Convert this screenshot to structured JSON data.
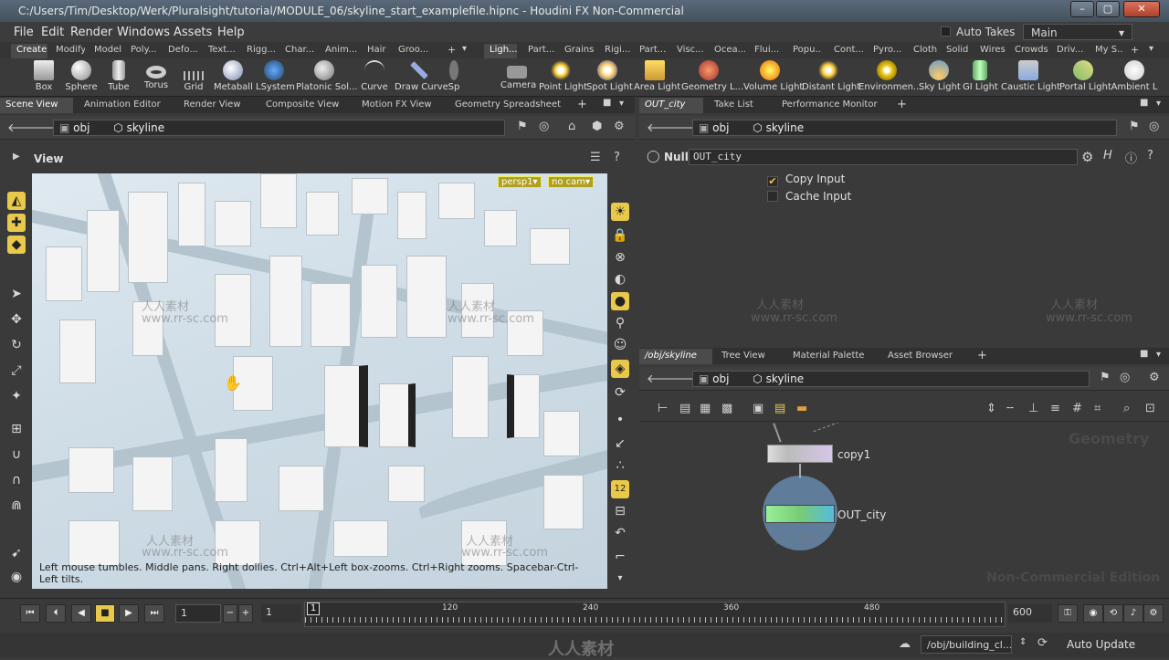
{
  "window": {
    "title": "C:/Users/Tim/Desktop/Werk/Pluralsight/tutorial/MODULE_06/skyline_start_examplefile.hipnc - Houdini FX Non-Commercial",
    "minimize": "–",
    "maximize": "▢",
    "close": "✕"
  },
  "menu": {
    "items": [
      "File",
      "Edit",
      "Render",
      "Windows",
      "Assets",
      "Help"
    ],
    "auto_takes": "Auto Takes",
    "desktop": "Main"
  },
  "shelf_tabs_left": [
    "Create",
    "Modify",
    "Model",
    "Poly...",
    "Defo...",
    "Text...",
    "Rigg...",
    "Char...",
    "Anim...",
    "Hair",
    "Groo..."
  ],
  "shelf_tabs_right": [
    "Ligh...",
    "Part...",
    "Grains",
    "Rigi...",
    "Part...",
    "Visc...",
    "Ocea...",
    "Flui...",
    "Popu...",
    "Cont...",
    "Pyro...",
    "Cloth",
    "Solid",
    "Wires",
    "Crowds",
    "Driv...",
    "My S..."
  ],
  "shelf_tools_left": [
    "Box",
    "Sphere",
    "Tube",
    "Torus",
    "Grid",
    "Metaball",
    "LSystem",
    "Platonic Sol...",
    "Curve",
    "Draw Curve",
    "Sp"
  ],
  "shelf_tools_right": [
    "Camera",
    "Point Light",
    "Spot Light",
    "Area Light",
    "Geometry L...",
    "Volume Light",
    "Distant Light",
    "Environmen...",
    "Sky Light",
    "GI Light",
    "Caustic Light",
    "Portal Light",
    "Ambient L"
  ],
  "left_pane": {
    "tabs": [
      "Scene View",
      "Animation Editor",
      "Render View",
      "Composite View",
      "Motion FX View",
      "Geometry Spreadsheet"
    ],
    "path_root": "obj",
    "path_node": "skyline",
    "view_title": "View",
    "persp": "persp1▾",
    "cam": "no cam▾",
    "hint": "Left mouse tumbles. Middle pans. Right dollies. Ctrl+Alt+Left box-zooms. Ctrl+Right zooms. Spacebar-Ctrl-Left tilts."
  },
  "right_top_pane": {
    "tabs": [
      "OUT_city",
      "Take List",
      "Performance Monitor"
    ],
    "path_root": "obj",
    "path_node": "skyline",
    "node_type": "Null",
    "node_name": "OUT_city",
    "copy_input": "Copy Input",
    "cache_input": "Cache Input"
  },
  "right_bottom_pane": {
    "tabs": [
      "/obj/skyline",
      "Tree View",
      "Material Palette",
      "Asset Browser"
    ],
    "path_root": "obj",
    "path_node": "skyline",
    "nodes": [
      "copy1",
      "OUT_city"
    ],
    "context": "Geometry",
    "watermark": "Non-Commercial Edition"
  },
  "timeline": {
    "frame": "1",
    "start": "1",
    "end": "600",
    "current_marker": "1",
    "ticks": [
      "120",
      "240",
      "360",
      "480"
    ]
  },
  "status": {
    "path": "/obj/building_cl...",
    "update": "Auto Update"
  },
  "watermarks": {
    "site": "www.rr-sc.com",
    "cn": "人人素材"
  }
}
